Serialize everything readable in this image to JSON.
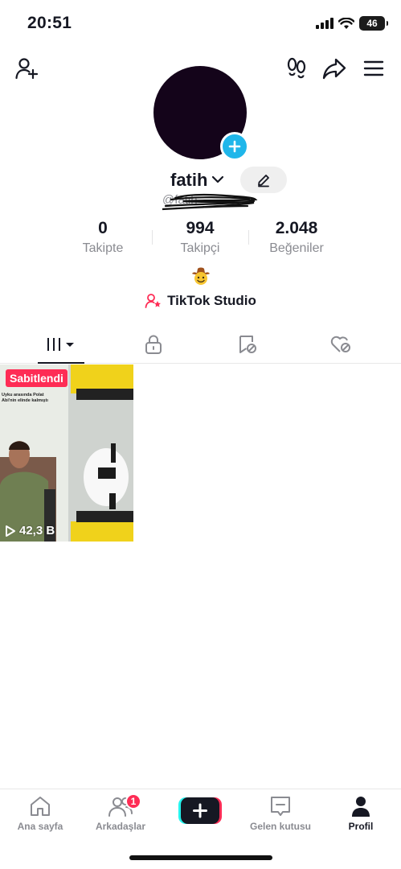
{
  "status_bar": {
    "time": "20:51",
    "battery": "46"
  },
  "profile": {
    "username": "fatih",
    "handle": "@fatih",
    "emoji": "🤠",
    "studio_label": "TikTok Studio"
  },
  "stats": [
    {
      "value": "0",
      "label": "Takipte"
    },
    {
      "value": "994",
      "label": "Takipçi"
    },
    {
      "value": "2.048",
      "label": "Beğeniler"
    }
  ],
  "tabs": [
    {
      "icon": "grid-icon"
    },
    {
      "icon": "lock-icon"
    },
    {
      "icon": "bookmark-icon"
    },
    {
      "icon": "liked-icon"
    }
  ],
  "video": {
    "pinned_label": "Sabitlendi",
    "views": "42,3 B",
    "caption_line1": "Uyku arasında Polat",
    "caption_line2": "Abi'nin elinde kalmıştı"
  },
  "bottom_nav": [
    {
      "label": "Ana sayfa",
      "icon": "home-icon"
    },
    {
      "label": "Arkadaşlar",
      "icon": "friends-icon",
      "badge": "1"
    },
    {
      "label": "",
      "icon": "create-icon"
    },
    {
      "label": "Gelen kutusu",
      "icon": "inbox-icon"
    },
    {
      "label": "Profil",
      "icon": "profile-icon"
    }
  ],
  "colors": {
    "accent": "#fe2c55",
    "avatar_plus": "#1fb6ea",
    "text": "#161823",
    "muted": "#8a8b91"
  }
}
